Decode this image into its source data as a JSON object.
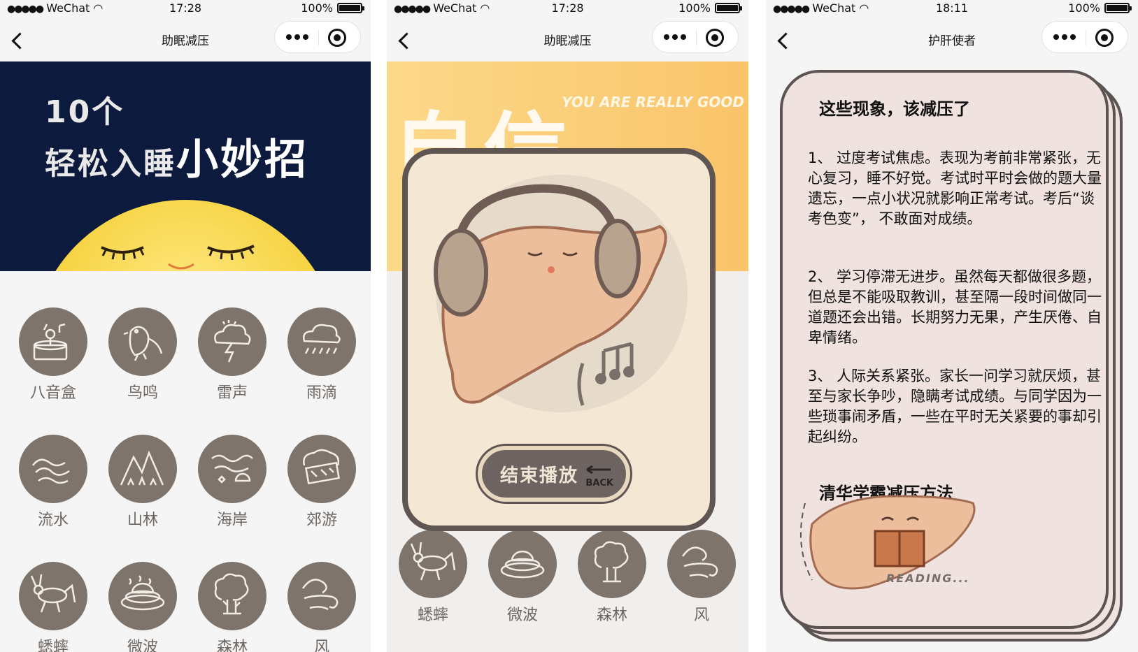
{
  "screens": [
    {
      "status": {
        "carrier": "WeChat",
        "time": "17:28",
        "battery": "100%"
      },
      "nav": {
        "title": "助眠减压"
      },
      "banner": {
        "line1": "10个",
        "line2_prefix": "轻松入睡",
        "line2_highlight": "小妙招"
      },
      "items": [
        {
          "label": "八音盒",
          "icon": "music-box-icon"
        },
        {
          "label": "鸟鸣",
          "icon": "bird-icon"
        },
        {
          "label": "雷声",
          "icon": "thunder-icon"
        },
        {
          "label": "雨滴",
          "icon": "rain-icon"
        },
        {
          "label": "流水",
          "icon": "water-icon"
        },
        {
          "label": "山林",
          "icon": "mountain-icon"
        },
        {
          "label": "海岸",
          "icon": "coast-icon"
        },
        {
          "label": "郊游",
          "icon": "outing-icon"
        },
        {
          "label": "蟋蟀",
          "icon": "cricket-icon"
        },
        {
          "label": "微波",
          "icon": "wave-icon"
        },
        {
          "label": "森林",
          "icon": "forest-icon"
        },
        {
          "label": "风",
          "icon": "wind-icon"
        }
      ]
    },
    {
      "status": {
        "carrier": "WeChat",
        "time": "17:28",
        "battery": "100%"
      },
      "nav": {
        "title": "助眠减压"
      },
      "banner": {
        "big": "自信",
        "slogan": "YOU ARE REALLY GOOD"
      },
      "items": [
        {
          "label": "蟋蟀",
          "icon": "cricket-icon"
        },
        {
          "label": "微波",
          "icon": "wave-icon"
        },
        {
          "label": "森林",
          "icon": "forest-icon"
        },
        {
          "label": "风",
          "icon": "wind-icon"
        }
      ],
      "modal": {
        "button": "结束播放",
        "button_sub": "BACK"
      }
    },
    {
      "status": {
        "carrier": "WeChat",
        "time": "18:11",
        "battery": "100%"
      },
      "nav": {
        "title": "护肝使者"
      },
      "card": {
        "title": "这些现象，该减压了",
        "paragraphs": [
          "1、 过度考试焦虑。表现为考前非常紧张，无心复习，睡不好觉。考试时平时会做的题大量遗忘，一点小状况就影响正常考试。考后“谈考色变”， 不敢面对成绩。",
          "2、 学习停滞无进步。虽然每天都做很多题，但总是不能吸取教训，甚至隔一段时间做同一道题还会出错。长期努力无果，产生厌倦、自卑情绪。",
          "3、 人际关系紧张。家长一问学习就厌烦，甚至与家长争吵，隐瞒考试成绩。与同学因为一些琐事闹矛盾，一些在平时无关紧要的事却引起纠纷。"
        ],
        "subtitle": "清华学霸减压方法",
        "reading": "READING..."
      }
    }
  ],
  "colors": {
    "icon_bg": "#7e746c",
    "banner_dark": "#0b1a3d",
    "card_bg": "#f0e3df"
  }
}
